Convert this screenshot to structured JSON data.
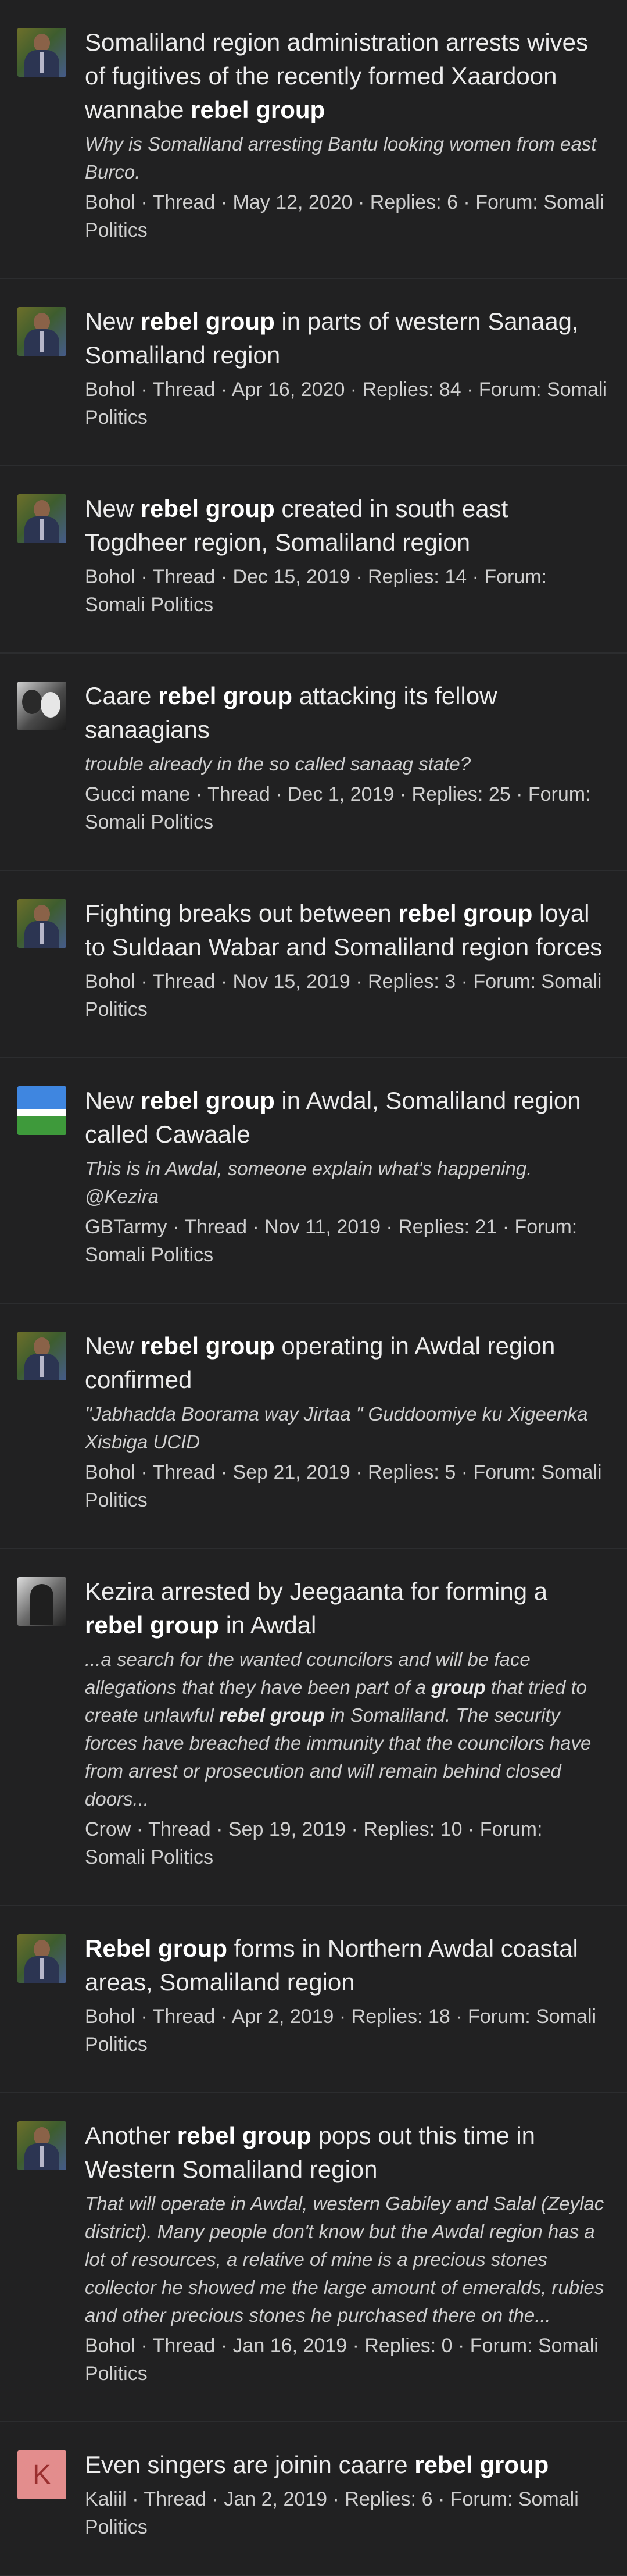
{
  "results": [
    {
      "avatar": "bohol-avatar",
      "title_parts": [
        [
          "Somaliland region administration arrests wives of fugitives of the recently formed Xaardoon wannabe ",
          false
        ],
        [
          "rebel group",
          true
        ]
      ],
      "snippet_parts": [
        [
          "Why is Somaliland arresting Bantu looking women from east Burco.",
          false
        ]
      ],
      "author": "Bohol",
      "type": "Thread",
      "date": "May 12, 2020",
      "replies": "Replies: 6",
      "forum": "Forum: Somali Politics"
    },
    {
      "avatar": "bohol-avatar",
      "title_parts": [
        [
          "New ",
          false
        ],
        [
          "rebel group",
          true
        ],
        [
          " in parts of western Sanaag, Somaliland region",
          false
        ]
      ],
      "snippet_parts": [],
      "author": "Bohol",
      "type": "Thread",
      "date": "Apr 16, 2020",
      "replies": "Replies: 84",
      "forum": "Forum: Somali Politics"
    },
    {
      "avatar": "bohol-avatar",
      "title_parts": [
        [
          "New ",
          false
        ],
        [
          "rebel group",
          true
        ],
        [
          " created in south east Togdheer region, Somaliland region",
          false
        ]
      ],
      "snippet_parts": [],
      "author": "Bohol",
      "type": "Thread",
      "date": "Dec 15, 2019",
      "replies": "Replies: 14",
      "forum": "Forum: Somali Politics"
    },
    {
      "avatar": "gucci-avatar",
      "title_parts": [
        [
          "Caare ",
          false
        ],
        [
          "rebel group",
          true
        ],
        [
          " attacking its fellow sanaagians",
          false
        ]
      ],
      "snippet_parts": [
        [
          "trouble already in the so called sanaag state?",
          false
        ]
      ],
      "author": "Gucci mane",
      "type": "Thread",
      "date": "Dec 1, 2019",
      "replies": "Replies: 25",
      "forum": "Forum: Somali Politics"
    },
    {
      "avatar": "bohol-avatar",
      "title_parts": [
        [
          "Fighting breaks out between ",
          false
        ],
        [
          "rebel group",
          true
        ],
        [
          " loyal to Suldaan Wabar and Somaliland region forces",
          false
        ]
      ],
      "snippet_parts": [],
      "author": "Bohol",
      "type": "Thread",
      "date": "Nov 15, 2019",
      "replies": "Replies: 3",
      "forum": "Forum: Somali Politics"
    },
    {
      "avatar": "gbtarmy-avatar",
      "title_parts": [
        [
          "New ",
          false
        ],
        [
          "rebel group",
          true
        ],
        [
          " in Awdal, Somaliland region called Cawaale",
          false
        ]
      ],
      "snippet_parts": [
        [
          "This is in Awdal, someone explain what's happening. @Kezira",
          false
        ]
      ],
      "author": "GBTarmy",
      "type": "Thread",
      "date": "Nov 11, 2019",
      "replies": "Replies: 21",
      "forum": "Forum: Somali Politics"
    },
    {
      "avatar": "bohol-avatar",
      "title_parts": [
        [
          "New ",
          false
        ],
        [
          "rebel group",
          true
        ],
        [
          " operating in Awdal region confirmed",
          false
        ]
      ],
      "snippet_parts": [
        [
          "\"Jabhadda Boorama way Jirtaa \" Guddoomiye ku Xigeenka Xisbiga UCID",
          false
        ]
      ],
      "author": "Bohol",
      "type": "Thread",
      "date": "Sep 21, 2019",
      "replies": "Replies: 5",
      "forum": "Forum: Somali Politics"
    },
    {
      "avatar": "crow-avatar",
      "title_parts": [
        [
          "Kezira arrested by Jeegaanta for forming a ",
          false
        ],
        [
          "rebel group",
          true
        ],
        [
          " in Awdal",
          false
        ]
      ],
      "snippet_parts": [
        [
          "...a search for the wanted councilors and will be face allegations that they have been part of a ",
          false
        ],
        [
          "group",
          true
        ],
        [
          " that tried to create unlawful ",
          false
        ],
        [
          "rebel group",
          true
        ],
        [
          " in Somaliland. The security forces have breached the immunity that the councilors have from arrest or prosecution and will remain behind closed doors...",
          false
        ]
      ],
      "author": "Crow",
      "type": "Thread",
      "date": "Sep 19, 2019",
      "replies": "Replies: 10",
      "forum": "Forum: Somali Politics"
    },
    {
      "avatar": "bohol-avatar",
      "title_parts": [
        [
          "Rebel group",
          true
        ],
        [
          " forms in Northern Awdal coastal areas, Somaliland region",
          false
        ]
      ],
      "snippet_parts": [],
      "author": "Bohol",
      "type": "Thread",
      "date": "Apr 2, 2019",
      "replies": "Replies: 18",
      "forum": "Forum: Somali Politics"
    },
    {
      "avatar": "bohol-avatar",
      "title_parts": [
        [
          "Another ",
          false
        ],
        [
          "rebel group",
          true
        ],
        [
          " pops out this time in Western Somaliland region",
          false
        ]
      ],
      "snippet_parts": [
        [
          "That will operate in Awdal, western Gabiley and Salal (Zeylac district). Many people don't know but the Awdal region has a lot of resources, a relative of mine is a precious stones collector he showed me the large amount of emeralds, rubies and other precious stones he purchased there on the...",
          false
        ]
      ],
      "author": "Bohol",
      "type": "Thread",
      "date": "Jan 16, 2019",
      "replies": "Replies: 0",
      "forum": "Forum: Somali Politics"
    },
    {
      "avatar": "letter-avatar",
      "avatar_letter": "K",
      "title_parts": [
        [
          "Even singers are joinin caarre ",
          false
        ],
        [
          "rebel group",
          true
        ]
      ],
      "snippet_parts": [],
      "author": "Kaliil",
      "type": "Thread",
      "date": "Jan 2, 2019",
      "replies": "Replies: 6",
      "forum": "Forum: Somali Politics"
    }
  ],
  "meta_separator": " · "
}
